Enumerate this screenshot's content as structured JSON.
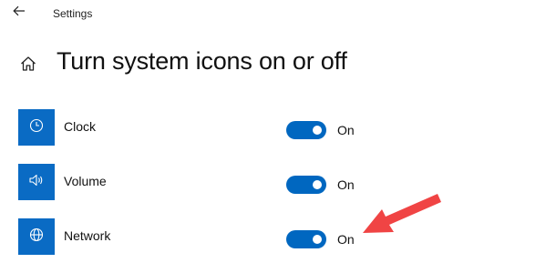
{
  "window": {
    "title": "Settings"
  },
  "page": {
    "title": "Turn system icons on or off"
  },
  "icons": {
    "back": "back-arrow-icon",
    "home": "home-icon"
  },
  "colors": {
    "accent": "#0067c0",
    "icon_tile": "#0a6bc4",
    "annotation_arrow": "#f04444"
  },
  "items": [
    {
      "label": "Clock",
      "icon": "clock-icon",
      "state": "On",
      "enabled": true
    },
    {
      "label": "Volume",
      "icon": "volume-icon",
      "state": "On",
      "enabled": true
    },
    {
      "label": "Network",
      "icon": "network-icon",
      "state": "On",
      "enabled": true
    }
  ]
}
